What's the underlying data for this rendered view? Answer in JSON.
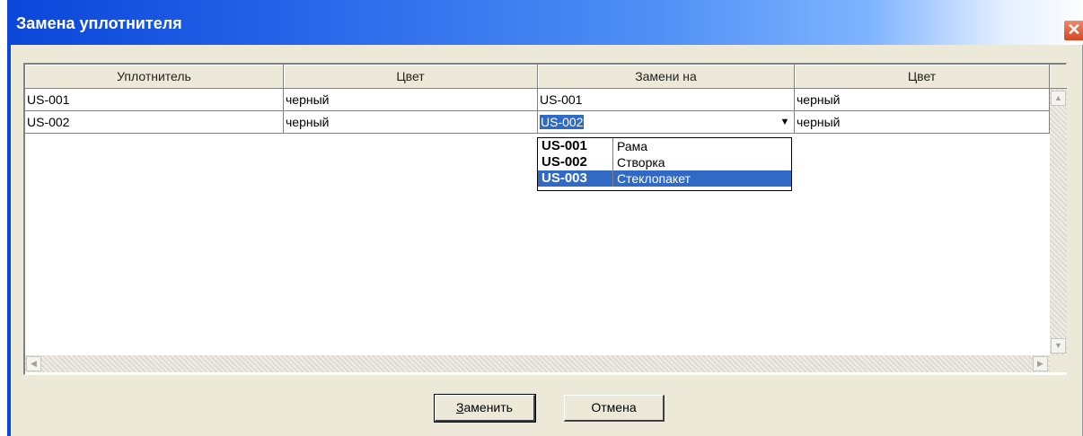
{
  "window": {
    "title": "Замена уплотнителя",
    "close_glyph": "✕"
  },
  "grid": {
    "columns": [
      "Уплотнитель",
      "Цвет",
      "Замени на",
      "Цвет"
    ],
    "rows": [
      [
        "US-001",
        "черный",
        "US-001",
        "черный"
      ],
      [
        "US-002",
        "черный",
        "US-002",
        "черный"
      ]
    ],
    "editing_value": "US-002"
  },
  "dropdown": {
    "items": [
      {
        "code": "US-001",
        "name": "Рама",
        "selected": false
      },
      {
        "code": "US-002",
        "name": "Створка",
        "selected": false
      },
      {
        "code": "US-003",
        "name": "Стеклопакет",
        "selected": true
      }
    ],
    "selection_color": "#316ac5"
  },
  "buttons": {
    "replace_mnemonic": "З",
    "replace_rest": "аменить",
    "cancel": "Отмена"
  },
  "icons": {
    "dropdown_arrow": "▼",
    "scroll_up": "▲",
    "scroll_down": "▼",
    "scroll_left": "◀",
    "scroll_right": "▶"
  }
}
